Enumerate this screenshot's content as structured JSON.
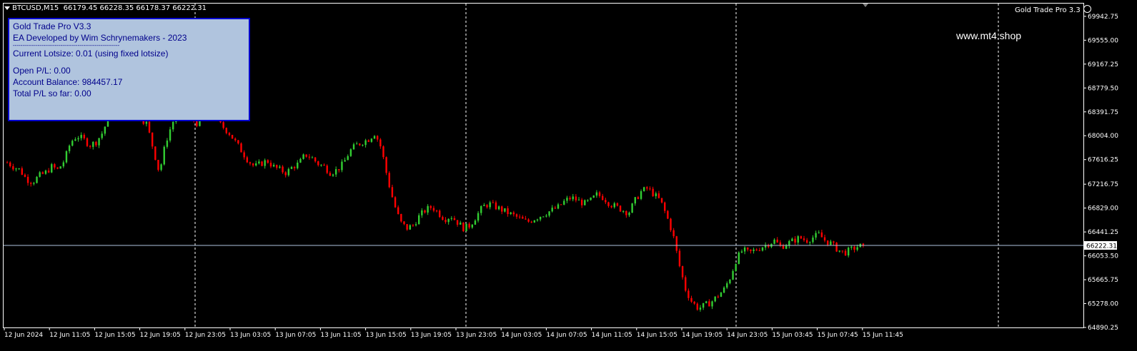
{
  "symbol": {
    "name": "BTCUSD,M15",
    "ohlc": "66179.45 66228.35 66178.37 66222.31"
  },
  "ea_name_label": "Gold Trade Pro 3.3",
  "ea_panel": {
    "title": "Gold Trade Pro V3.3",
    "developer": "EA Developed by Wim Schrynemakers - 2023",
    "separator": "--------------------------------------------------------",
    "lotsize": "Current Lotsize: 0.01 (using fixed lotsize)",
    "open_pl": "Open P/L: 0.00",
    "balance": "Account Balance: 984457.17",
    "total_pl": "Total P/L so far: 0.00"
  },
  "watermark": "www.mt4.shop",
  "colors": {
    "background": "#000000",
    "bull": "#32cd32",
    "bear": "#ff0000",
    "grid": "#ffffff",
    "bid_line": "#b0c4de",
    "price_label_bg": "#ffffff"
  },
  "chart_data": {
    "type": "candlestick",
    "symbol": "BTCUSD",
    "timeframe": "M15",
    "current_price": 66222.31,
    "current_price_label": "66222.31",
    "ylim": [
      64890.25,
      70150
    ],
    "y_ticks": [
      "69942.75",
      "69555.00",
      "69167.25",
      "68779.50",
      "68391.75",
      "68004.00",
      "67616.25",
      "67216.75",
      "66829.00",
      "66441.25",
      "66053.50",
      "65665.75",
      "65278.00",
      "64890.25"
    ],
    "x_ticks": [
      "12 Jun 2024",
      "12 Jun 11:05",
      "12 Jun 15:05",
      "12 Jun 19:05",
      "12 Jun 23:05",
      "13 Jun 03:05",
      "13 Jun 07:05",
      "13 Jun 11:05",
      "13 Jun 15:05",
      "13 Jun 19:05",
      "13 Jun 23:05",
      "14 Jun 03:05",
      "14 Jun 07:05",
      "14 Jun 11:05",
      "14 Jun 15:05",
      "14 Jun 19:05",
      "14 Jun 23:05",
      "15 Jun 03:45",
      "15 Jun 07:45",
      "15 Jun 11:45"
    ],
    "period_separators": [
      "12 Jun 23:05",
      "13 Jun 23:05",
      "14 Jun 23:05",
      "15 Jun 23:05"
    ],
    "close_path": [
      67570,
      67500,
      67450,
      67300,
      67250,
      67350,
      67400,
      67500,
      67450,
      67600,
      67900,
      68000,
      67950,
      67850,
      67900,
      68050,
      68300,
      68700,
      68950,
      68850,
      68500,
      68300,
      68200,
      67800,
      67400,
      67900,
      68200,
      68400,
      68450,
      68300,
      68200,
      68300,
      68400,
      68250,
      68150,
      68050,
      67900,
      67750,
      67600,
      67500,
      67550,
      67600,
      67500,
      67450,
      67400,
      67500,
      67550,
      67700,
      67650,
      67550,
      67500,
      67400,
      67450,
      67550,
      67750,
      67850,
      67900,
      67950,
      68050,
      67800,
      67300,
      66900,
      66600,
      66500,
      66550,
      66700,
      66800,
      66850,
      66750,
      66650,
      66700,
      66600,
      66500,
      66550,
      66700,
      66850,
      66900,
      66850,
      66800,
      66750,
      66700,
      66650,
      66600,
      66650,
      66700,
      66750,
      66800,
      66850,
      66950,
      67000,
      66950,
      66900,
      66950,
      67050,
      67000,
      66900,
      66850,
      66800,
      66750,
      66950,
      67100,
      67150,
      67050,
      66950,
      66700,
      66400,
      65900,
      65500,
      65300,
      65200,
      65250,
      65300,
      65400,
      65500,
      65700,
      66000,
      66150,
      66100,
      66150,
      66200,
      66250,
      66300,
      66200,
      66250,
      66300,
      66350,
      66300,
      66350,
      66400,
      66300,
      66250,
      66150,
      66100,
      66150,
      66200,
      66222
    ]
  }
}
